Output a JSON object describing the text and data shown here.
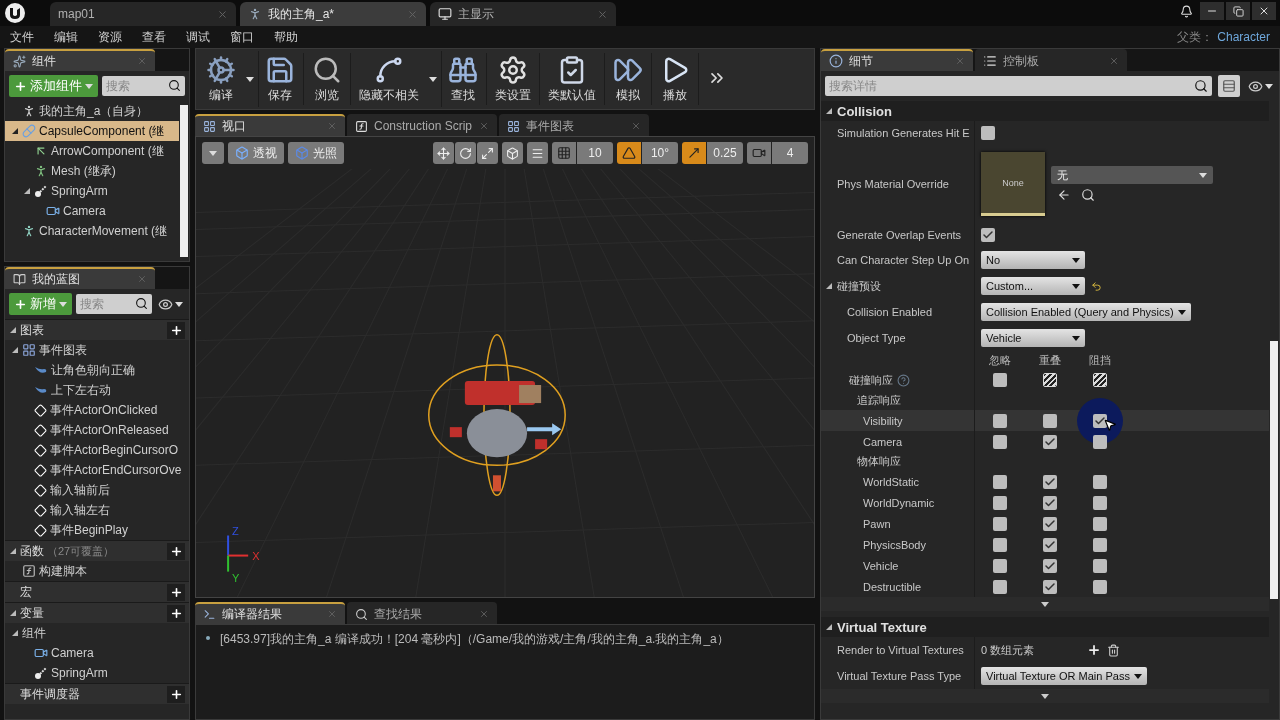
{
  "title_bar": {
    "tabs": [
      {
        "label": "map01",
        "kind": "level",
        "selected": false
      },
      {
        "label": "我的主角_a*",
        "kind": "blueprint",
        "selected": true
      },
      {
        "label": "主显示",
        "kind": "display",
        "selected": false
      }
    ]
  },
  "menu": [
    "文件",
    "编辑",
    "资源",
    "查看",
    "调试",
    "窗口",
    "帮助"
  ],
  "parent_class": {
    "label": "父类：",
    "value": "Character"
  },
  "components": {
    "tab": "组件",
    "add_button": "添加组件",
    "search_placeholder": "搜索",
    "tree": [
      {
        "label": "我的主角_a（自身）",
        "kind": "actor",
        "selected": false
      },
      {
        "label": "CapsuleComponent (继",
        "kind": "capsule",
        "selected": true,
        "expanded": true,
        "children": [
          {
            "label": "ArrowComponent (继",
            "kind": "arrow",
            "selected": false
          },
          {
            "label": "Mesh (继承)",
            "kind": "mesh",
            "selected": false
          },
          {
            "label": "SpringArm",
            "kind": "springarm",
            "selected": false,
            "expanded": true,
            "children": [
              {
                "label": "Camera",
                "kind": "camera",
                "selected": false
              }
            ]
          }
        ]
      },
      {
        "label": "CharacterMovement (继",
        "kind": "movement",
        "selected": false
      }
    ]
  },
  "my_blueprint": {
    "tab": "我的蓝图",
    "new_button": "新增",
    "search_placeholder": "搜索",
    "sections": [
      {
        "title": "图表",
        "expanded": true,
        "tree": [
          {
            "label": "事件图表",
            "kind": "graph",
            "expanded": true,
            "children": [
              {
                "label": "让角色朝向正确",
                "kind": "custom-event"
              },
              {
                "label": "上下左右动",
                "kind": "custom-event"
              },
              {
                "label": "事件ActorOnClicked",
                "kind": "event"
              },
              {
                "label": "事件ActorOnReleased",
                "kind": "event"
              },
              {
                "label": "事件ActorBeginCursorO",
                "kind": "event"
              },
              {
                "label": "事件ActorEndCursorOve",
                "kind": "event"
              },
              {
                "label": "输入轴前后",
                "kind": "event"
              },
              {
                "label": "输入轴左右",
                "kind": "event"
              },
              {
                "label": "事件BeginPlay",
                "kind": "event"
              }
            ]
          }
        ]
      },
      {
        "title": "函数",
        "note": "（27可覆盖）",
        "expanded": true,
        "tree": [
          {
            "label": "构建脚本",
            "kind": "function"
          }
        ]
      },
      {
        "title": "宏"
      },
      {
        "title": "变量",
        "expanded": true,
        "tree": [
          {
            "label": "组件",
            "kind": "folder",
            "expanded": true,
            "children": [
              {
                "label": "Camera",
                "kind": "camera"
              },
              {
                "label": "SpringArm",
                "kind": "springarm"
              }
            ]
          }
        ]
      },
      {
        "title": "事件调度器"
      }
    ]
  },
  "toolbar": [
    {
      "label": "编译",
      "kind": "compile",
      "caret": true
    },
    {
      "label": "保存",
      "kind": "save"
    },
    {
      "label": "浏览",
      "kind": "browse"
    },
    {
      "label": "隐藏不相关",
      "kind": "hide",
      "caret": true
    },
    {
      "label": "查找",
      "kind": "find"
    },
    {
      "label": "类设置",
      "kind": "class-settings"
    },
    {
      "label": "类默认值",
      "kind": "class-defaults"
    },
    {
      "label": "模拟",
      "kind": "simulate"
    },
    {
      "label": "播放",
      "kind": "play"
    }
  ],
  "editor_tabs": [
    {
      "label": "视口",
      "kind": "viewport",
      "selected": true
    },
    {
      "label": "Construction Scrip",
      "kind": "function",
      "selected": false
    },
    {
      "label": "事件图表",
      "kind": "graph",
      "selected": false
    }
  ],
  "viewport": {
    "view_buttons": [
      {
        "kind": "menu"
      },
      {
        "kind": "view",
        "label": "透视"
      },
      {
        "kind": "lighting",
        "label": "光照"
      }
    ],
    "snaps": [
      {
        "kind": "grid",
        "value": "10",
        "on": false
      },
      {
        "kind": "angle",
        "value": "10°",
        "on": true
      },
      {
        "kind": "scale",
        "value": "0.25",
        "on": true
      },
      {
        "kind": "camera-speed",
        "value": "4",
        "on": false
      }
    ],
    "axis_labels": {
      "x": "X",
      "y": "Y",
      "z": "Z"
    }
  },
  "output": {
    "tabs": [
      {
        "label": "编译器结果",
        "kind": "console",
        "selected": true
      },
      {
        "label": "查找结果",
        "kind": "find",
        "selected": false
      }
    ],
    "messages": [
      "[6453.97]我的主角_a 编译成功！[204 毫秒内]（/Game/我的游戏/主角/我的主角_a.我的主角_a）"
    ]
  },
  "details": {
    "tabs": [
      {
        "label": "细节",
        "kind": "details",
        "selected": true
      },
      {
        "label": "控制板",
        "kind": "palette",
        "selected": false
      }
    ],
    "search_placeholder": "搜索详情",
    "sections": [
      {
        "title": "Collision",
        "expanded": true,
        "rows": [
          {
            "kind": "checkbox",
            "label": "Simulation Generates Hit E",
            "checked": false
          },
          {
            "kind": "asset",
            "label": "Phys Material Override",
            "thumbnail": "None",
            "value": "无"
          },
          {
            "kind": "checkbox",
            "label": "Generate Overlap Events",
            "checked": true
          },
          {
            "kind": "dropdown",
            "label": "Can Character Step Up On",
            "value": "No"
          },
          {
            "kind": "dropdown",
            "label": "碰撞预设",
            "value": "Custom...",
            "expanded": true,
            "reset": true,
            "children": [
              {
                "kind": "dropdown",
                "label": "Collision Enabled",
                "value": "Collision Enabled (Query and Physics)"
              },
              {
                "kind": "dropdown",
                "label": "Object Type",
                "value": "Vehicle"
              },
              {
                "kind": "responses",
                "columns": [
                  "忽略",
                  "重叠",
                  "阻挡"
                ],
                "header": {
                  "label": "碰撞响应",
                  "cells": [
                    {
                      "checked": false
                    },
                    {
                      "mixed": true
                    },
                    {
                      "mixed": true
                    }
                  ]
                },
                "groups": [
                  {
                    "label": "追踪响应",
                    "channels": [
                      {
                        "label": "Visibility",
                        "hovered": true,
                        "cells": [
                          false,
                          false,
                          true
                        ]
                      },
                      {
                        "label": "Camera",
                        "hovered": false,
                        "cells": [
                          false,
                          true,
                          false
                        ]
                      }
                    ]
                  },
                  {
                    "label": "物体响应",
                    "channels": [
                      {
                        "label": "WorldStatic",
                        "hovered": false,
                        "cells": [
                          false,
                          true,
                          false
                        ]
                      },
                      {
                        "label": "WorldDynamic",
                        "hovered": false,
                        "cells": [
                          false,
                          true,
                          false
                        ]
                      },
                      {
                        "label": "Pawn",
                        "hovered": false,
                        "cells": [
                          false,
                          true,
                          false
                        ]
                      },
                      {
                        "label": "PhysicsBody",
                        "hovered": false,
                        "cells": [
                          false,
                          true,
                          false
                        ]
                      },
                      {
                        "label": "Vehicle",
                        "hovered": false,
                        "cells": [
                          false,
                          true,
                          false
                        ]
                      },
                      {
                        "label": "Destructible",
                        "hovered": false,
                        "cells": [
                          false,
                          true,
                          false
                        ]
                      }
                    ]
                  }
                ]
              }
            ]
          }
        ]
      },
      {
        "title": "Virtual Texture",
        "expanded": true,
        "rows": [
          {
            "kind": "array",
            "label": "Render to Virtual Textures",
            "value": "0 数组元素"
          },
          {
            "kind": "dropdown",
            "label": "Virtual Texture Pass Type",
            "value": "Virtual Texture OR Main Pass"
          }
        ]
      }
    ]
  }
}
